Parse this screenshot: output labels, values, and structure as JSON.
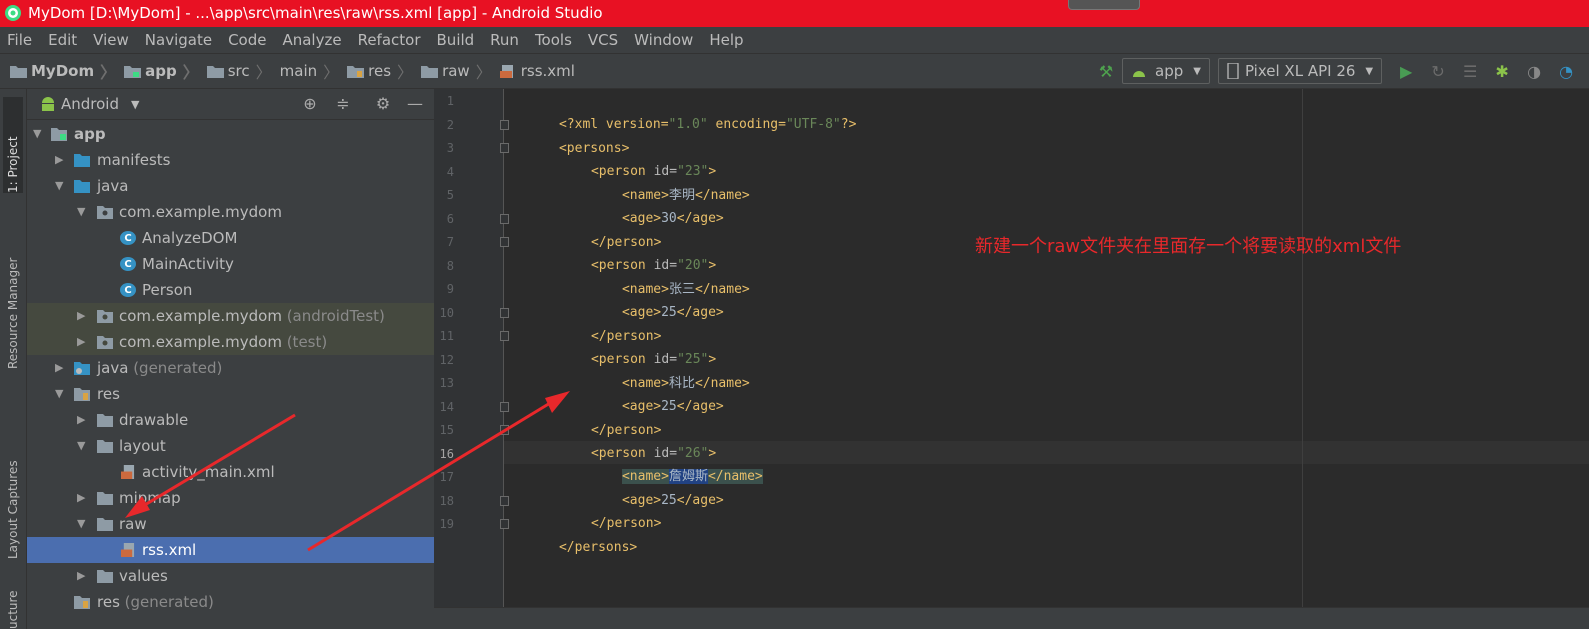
{
  "window": {
    "title": "MyDom [D:\\MyDom] - ...\\app\\src\\main\\res\\raw\\rss.xml [app] - Android Studio"
  },
  "menu": [
    "File",
    "Edit",
    "View",
    "Navigate",
    "Code",
    "Analyze",
    "Refactor",
    "Build",
    "Run",
    "Tools",
    "VCS",
    "Window",
    "Help"
  ],
  "breadcrumb": [
    "MyDom",
    "app",
    "src",
    "main",
    "res",
    "raw",
    "rss.xml"
  ],
  "toolbar": {
    "module": "app",
    "device": "Pixel XL API 26"
  },
  "side_tabs": {
    "project": "1: Project",
    "resource_manager": "Resource Manager",
    "layout_captures": "Layout Captures",
    "structure": "ucture"
  },
  "project_panel": {
    "view": "Android",
    "tree": [
      {
        "label": "app",
        "suffix": ""
      },
      {
        "label": "manifests",
        "suffix": ""
      },
      {
        "label": "java",
        "suffix": ""
      },
      {
        "label": "com.example.mydom",
        "suffix": ""
      },
      {
        "label": "AnalyzeDOM",
        "suffix": ""
      },
      {
        "label": "MainActivity",
        "suffix": ""
      },
      {
        "label": "Person",
        "suffix": ""
      },
      {
        "label": "com.example.mydom",
        "suffix": " (androidTest)"
      },
      {
        "label": "com.example.mydom",
        "suffix": " (test)"
      },
      {
        "label": "java",
        "suffix": " (generated)"
      },
      {
        "label": "res",
        "suffix": ""
      },
      {
        "label": "drawable",
        "suffix": ""
      },
      {
        "label": "layout",
        "suffix": ""
      },
      {
        "label": "activity_main.xml",
        "suffix": ""
      },
      {
        "label": "mipmap",
        "suffix": ""
      },
      {
        "label": "raw",
        "suffix": ""
      },
      {
        "label": "rss.xml",
        "suffix": ""
      },
      {
        "label": "values",
        "suffix": ""
      },
      {
        "label": "res",
        "suffix": " (generated)"
      }
    ]
  },
  "editor": {
    "line_numbers": [
      "1",
      "2",
      "3",
      "4",
      "5",
      "6",
      "7",
      "8",
      "9",
      "10",
      "11",
      "12",
      "13",
      "14",
      "15",
      "16",
      "17",
      "18",
      "19"
    ],
    "code": {
      "decl_open": "<?xml version=",
      "decl_ver": "\"1.0\"",
      "decl_enc": " encoding=",
      "decl_enc_val": "\"UTF-8\"",
      "decl_close": "?>",
      "persons_open": "<persons>",
      "persons_close": "</persons>",
      "person_open": "<person",
      "attr_id": " id=",
      "person_close": "</person>",
      "gt": ">",
      "name_open": "<name>",
      "name_close": "</name>",
      "age_open": "<age>",
      "age_close": "</age>",
      "p1_id": "\"23\"",
      "p1_name": "李明",
      "p1_age": "30",
      "p2_id": "\"20\"",
      "p2_name": "张三",
      "p2_age": "25",
      "p3_id": "\"25\"",
      "p3_name": "科比",
      "p3_age": "25",
      "p4_id": "\"26\"",
      "p4_name": "詹姆斯",
      "p4_age": "25"
    },
    "annotation": "新建一个raw文件夹在里面存一个将要读取的xml文件"
  },
  "colors": {
    "title_bar": "#e81123",
    "selection": "#4b6eaf",
    "annotation": "#e8282b"
  }
}
